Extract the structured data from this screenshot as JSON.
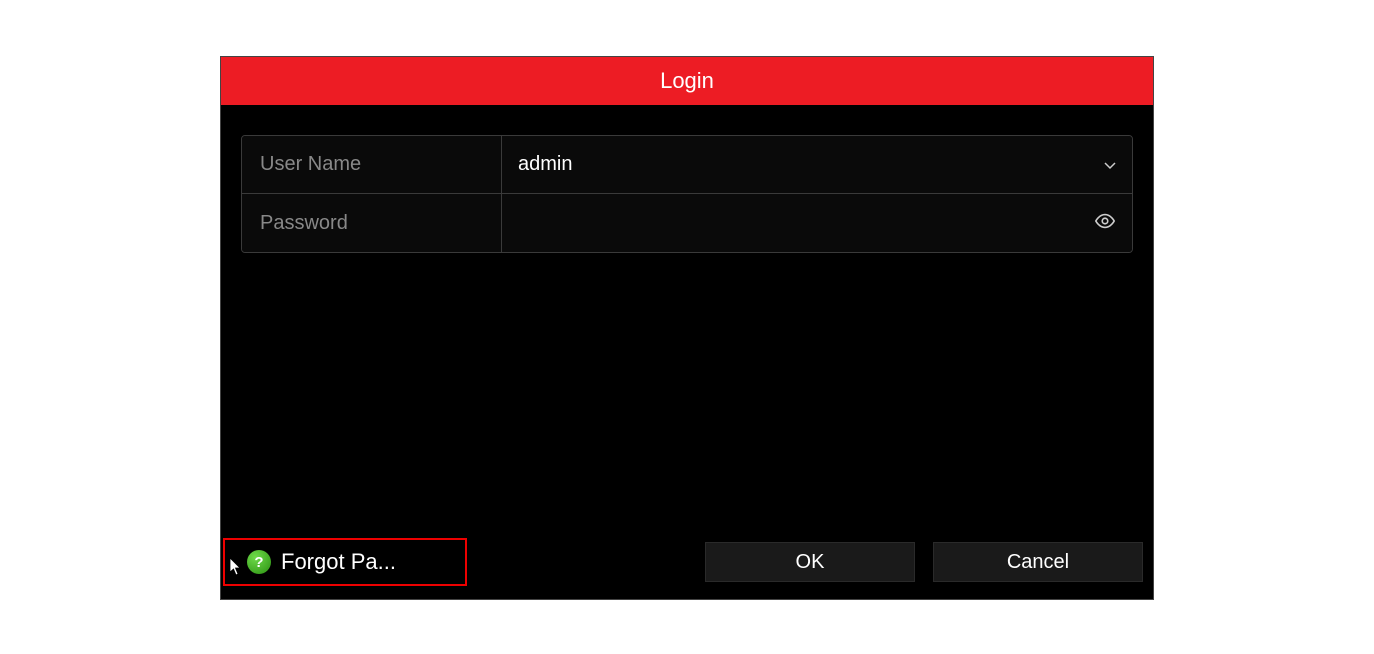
{
  "dialog": {
    "title": "Login"
  },
  "form": {
    "username": {
      "label": "User Name",
      "value": "admin"
    },
    "password": {
      "label": "Password",
      "value": ""
    }
  },
  "footer": {
    "forgot_label": "Forgot Pa...",
    "ok_label": "OK",
    "cancel_label": "Cancel"
  }
}
